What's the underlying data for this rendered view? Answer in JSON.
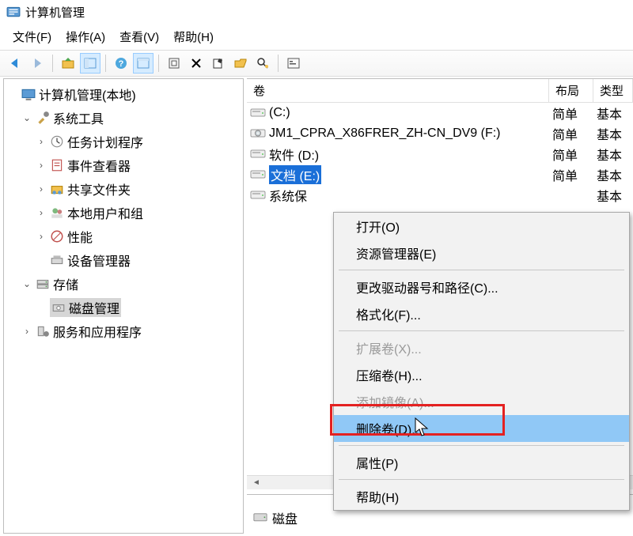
{
  "title": "计算机管理",
  "menus": {
    "file": "文件(F)",
    "action": "操作(A)",
    "view": "查看(V)",
    "help": "帮助(H)"
  },
  "tree": {
    "root": "计算机管理(本地)",
    "system_tools": "系统工具",
    "task_scheduler": "任务计划程序",
    "event_viewer": "事件查看器",
    "shared_folders": "共享文件夹",
    "local_users": "本地用户和组",
    "performance": "性能",
    "device_manager": "设备管理器",
    "storage": "存储",
    "disk_management": "磁盘管理",
    "services_apps": "服务和应用程序"
  },
  "columns": {
    "volume": "卷",
    "layout": "布局",
    "type": "类型"
  },
  "rows": [
    {
      "icon": "drive",
      "label": "(C:)",
      "layout": "简单",
      "type": "基本"
    },
    {
      "icon": "cd",
      "label": "JM1_CPRA_X86FRER_ZH-CN_DV9 (F:)",
      "layout": "简单",
      "type": "基本"
    },
    {
      "icon": "drive",
      "label": "软件 (D:)",
      "layout": "简单",
      "type": "基本"
    },
    {
      "icon": "drive",
      "label": "文档 (E:)",
      "layout": "简单",
      "type": "基本",
      "selected": true
    },
    {
      "icon": "drive",
      "label": "系统保",
      "layout": "",
      "type": "基本"
    }
  ],
  "context_menu": {
    "open": "打开(O)",
    "explorer": "资源管理器(E)",
    "change_letter": "更改驱动器号和路径(C)...",
    "format": "格式化(F)...",
    "extend": "扩展卷(X)...",
    "shrink": "压缩卷(H)...",
    "add_mirror": "添加镜像(A)...",
    "delete": "删除卷(D)...",
    "properties": "属性(P)",
    "help": "帮助(H)"
  },
  "bottom_label": "磁盘"
}
